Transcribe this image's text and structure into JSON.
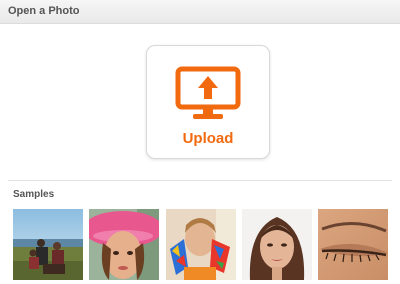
{
  "header": {
    "title": "Open a Photo"
  },
  "upload": {
    "label": "Upload",
    "icon": "monitor-upload-icon",
    "accent": "#f26a10"
  },
  "samples": {
    "title": "Samples",
    "items": [
      {
        "name": "sample-photo-outdoor-group"
      },
      {
        "name": "sample-photo-girl-pink-hat"
      },
      {
        "name": "sample-photo-painted-hands"
      },
      {
        "name": "sample-photo-woman-portrait"
      },
      {
        "name": "sample-photo-eye-closeup"
      }
    ]
  }
}
